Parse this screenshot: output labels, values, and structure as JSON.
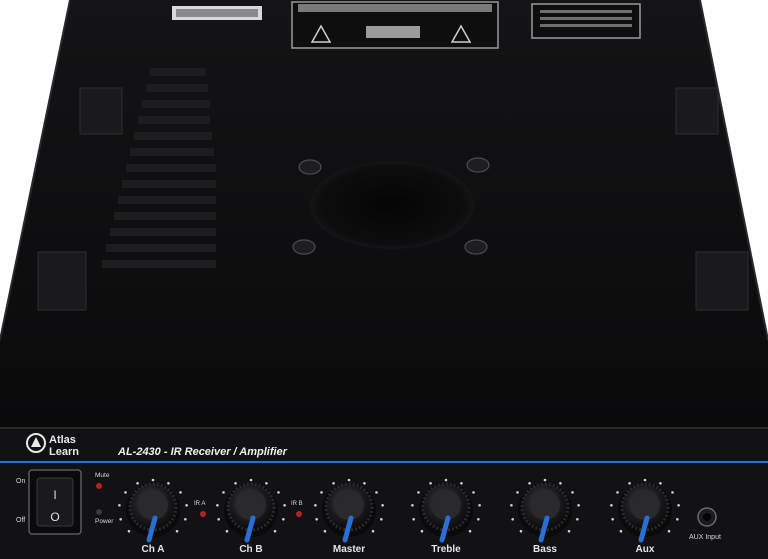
{
  "device": {
    "brand_line1": "Atlas",
    "brand_line2": "Learn",
    "model_title": "AL-2430 - IR Receiver / Amplifier"
  },
  "panel": {
    "switch_on_label": "On",
    "switch_off_label": "Off",
    "switch_on_glyph": "I",
    "switch_off_glyph": "O",
    "mute_label": "Mute",
    "power_label": "Power",
    "ir_a_label": "IR A",
    "ir_b_label": "IR B",
    "aux_label": "AUX Input"
  },
  "knobs": [
    {
      "label": "Ch A"
    },
    {
      "label": "Ch B"
    },
    {
      "label": "Master"
    },
    {
      "label": "Treble"
    },
    {
      "label": "Bass"
    },
    {
      "label": "Aux"
    }
  ],
  "colors": {
    "chassis": "#0b0b0c",
    "front_panel": "#121214",
    "accent_blue": "#2a6fd6",
    "led_red": "#b3231d"
  },
  "icons": [
    "atlas-logo-icon",
    "rocker-switch-icon",
    "led-icon",
    "knob-icon",
    "aux-jack-icon",
    "warning-triangle-icon",
    "lightning-warning-icon"
  ]
}
